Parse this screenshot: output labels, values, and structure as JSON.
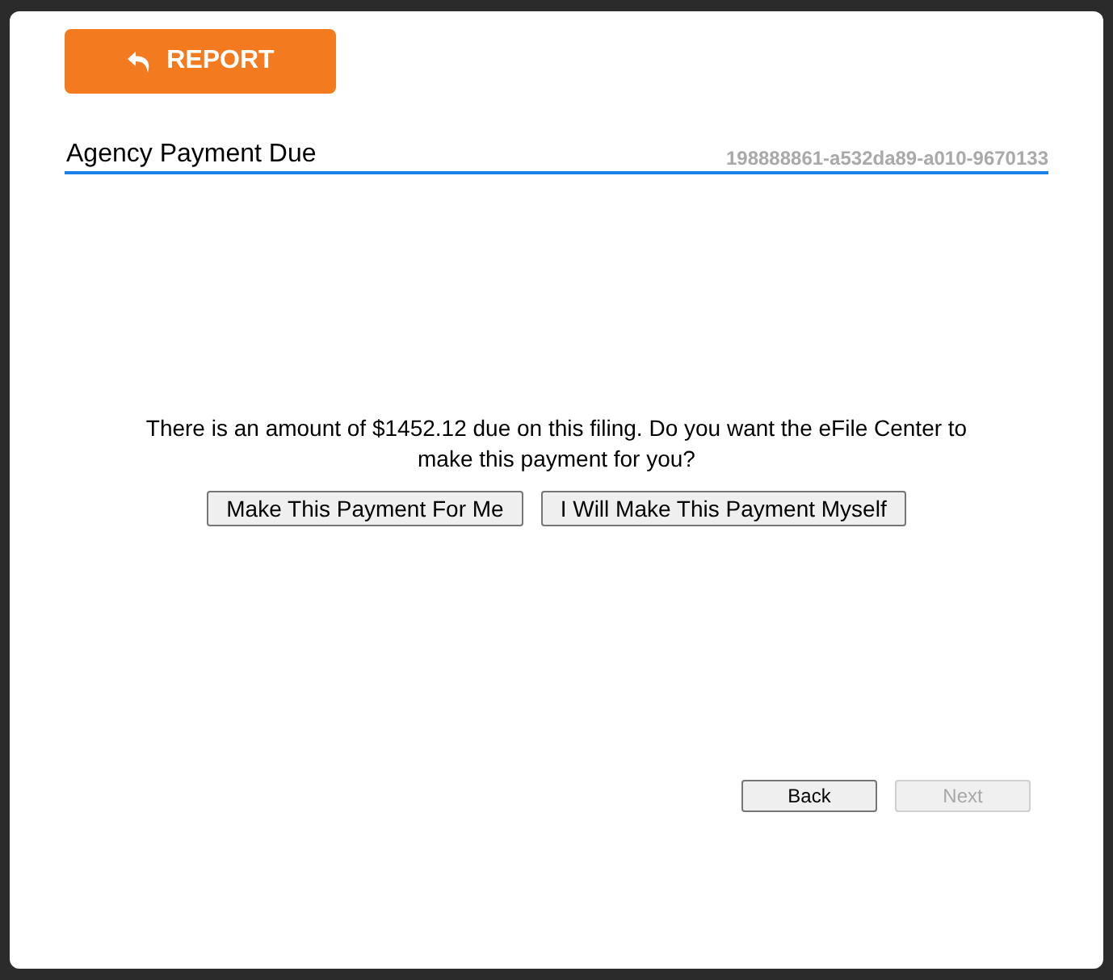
{
  "dialog": {
    "report_button": {
      "label": "REPORT"
    },
    "title": "Agency Payment Due",
    "reference": "198888861-a532da89-a010-9670133",
    "message": "There is an amount of $1452.12 due on this filing. Do you want the eFile Center to make this payment for you?",
    "choices": [
      {
        "label": "Make This Payment For Me"
      },
      {
        "label": "I Will Make This Payment Myself"
      }
    ],
    "nav": [
      {
        "label": "Back",
        "disabled": false
      },
      {
        "label": "Next",
        "disabled": true
      }
    ]
  }
}
